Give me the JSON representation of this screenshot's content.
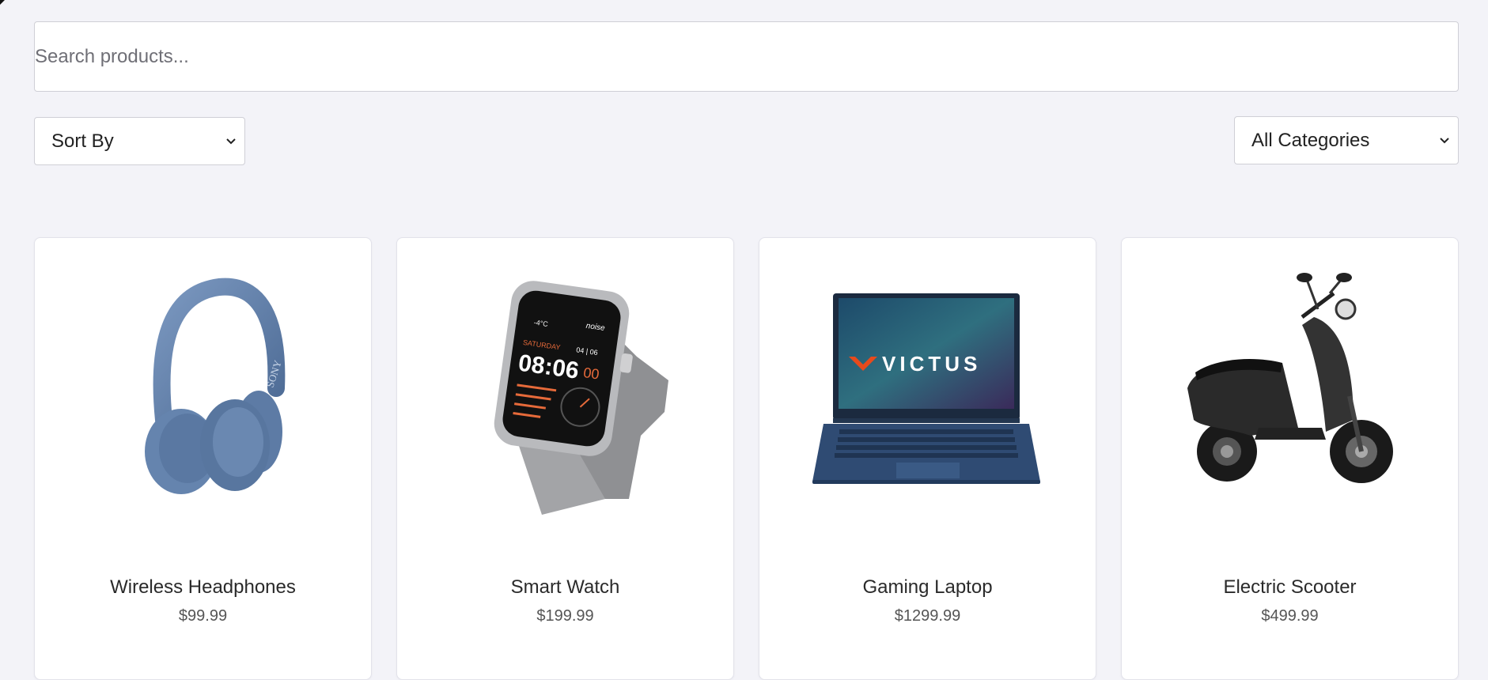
{
  "search": {
    "placeholder": "Search products...",
    "value": ""
  },
  "filters": {
    "sort_label": "Sort By",
    "category_label": "All Categories"
  },
  "products": [
    {
      "name": "Wireless Headphones",
      "price": "$99.99",
      "icon": "headphones-image",
      "image_text": "SONY"
    },
    {
      "name": "Smart Watch",
      "price": "$199.99",
      "icon": "smartwatch-image",
      "image_text": "08:06"
    },
    {
      "name": "Gaming Laptop",
      "price": "$1299.99",
      "icon": "laptop-image",
      "image_text": "VICTUS"
    },
    {
      "name": "Electric Scooter",
      "price": "$499.99",
      "icon": "scooter-image",
      "image_text": ""
    }
  ],
  "colors": {
    "background": "#f3f3f8",
    "card": "#ffffff",
    "border": "#cfcfd6",
    "headphones": "#5d7ba5",
    "laptop": "#2f4b73"
  }
}
